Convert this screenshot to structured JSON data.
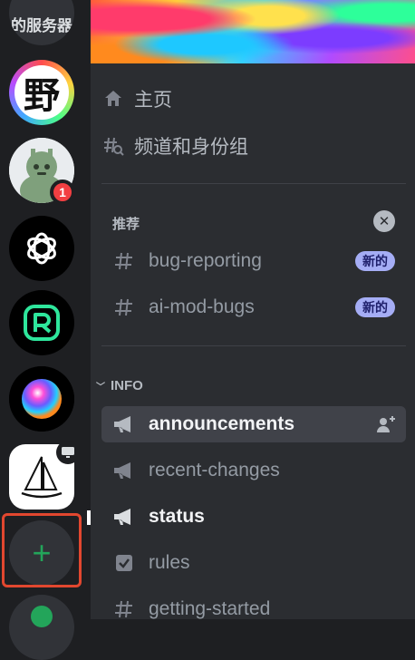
{
  "servers": {
    "top_partial_label": "的服务器",
    "ye_logo_text": "野",
    "bot_mention_count": "1",
    "add_server_symbol": "+"
  },
  "panel": {
    "home_label": "主页",
    "channels_roles_label": "频道和身份组",
    "recommended": {
      "header": "推荐",
      "items": [
        {
          "name": "bug-reporting",
          "badge": "新的"
        },
        {
          "name": "ai-mod-bugs",
          "badge": "新的"
        }
      ]
    },
    "info_category": "INFO",
    "channels": [
      {
        "name": "announcements",
        "type": "announcement",
        "state": "selected"
      },
      {
        "name": "recent-changes",
        "type": "announcement",
        "state": "normal"
      },
      {
        "name": "status",
        "type": "announcement",
        "state": "unread"
      },
      {
        "name": "rules",
        "type": "rules",
        "state": "normal"
      },
      {
        "name": "getting-started",
        "type": "text",
        "state": "normal"
      }
    ]
  },
  "colors": {
    "accent": "#5865f2",
    "mention_red": "#f23f42",
    "add_green": "#23a55a",
    "highlight_annotation": "#e2472f"
  }
}
